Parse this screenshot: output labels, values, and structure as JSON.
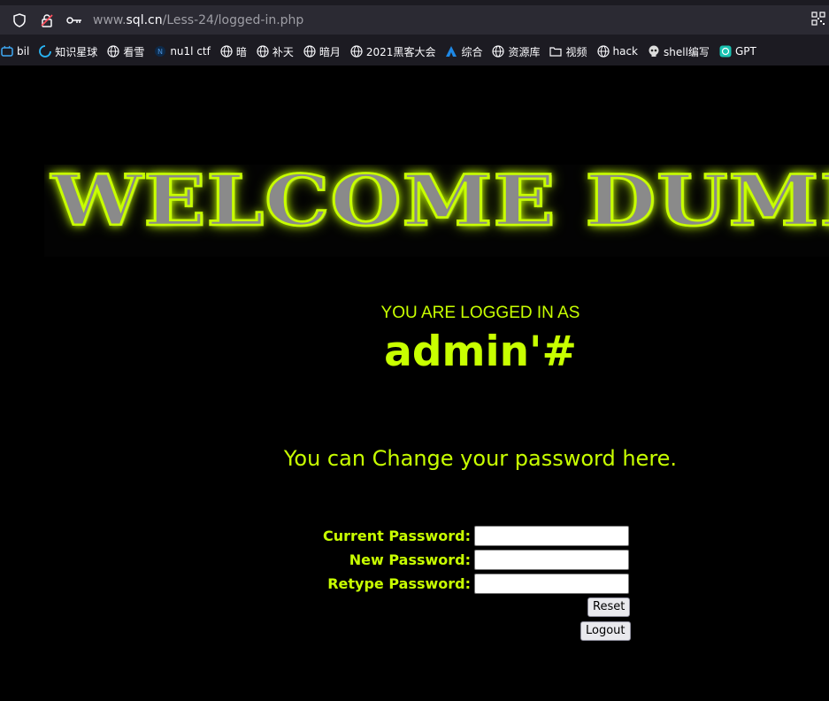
{
  "browser": {
    "url_prefix": "www.",
    "url_domain": "sql.cn",
    "url_path": "/Less-24/logged-in.php",
    "bookmarks": [
      {
        "label": "bil",
        "icon": "bilibili-icon"
      },
      {
        "label": "知识星球",
        "icon": "planet-icon"
      },
      {
        "label": "看雪",
        "icon": "globe-icon"
      },
      {
        "label": "nu1l ctf",
        "icon": "nu1l-icon"
      },
      {
        "label": "暗",
        "icon": "globe-icon"
      },
      {
        "label": "补天",
        "icon": "globe-icon"
      },
      {
        "label": "暗月",
        "icon": "globe-icon"
      },
      {
        "label": "2021黑客大会",
        "icon": "globe-icon"
      },
      {
        "label": "综合",
        "icon": "triangle-icon"
      },
      {
        "label": "资源库",
        "icon": "globe-icon"
      },
      {
        "label": "视频",
        "icon": "folder-icon"
      },
      {
        "label": "hack",
        "icon": "globe-icon"
      },
      {
        "label": "shell编写",
        "icon": "skull-icon"
      },
      {
        "label": "GPT",
        "icon": "gpt-icon"
      }
    ]
  },
  "page": {
    "banner_text": "WELCOME DUMB",
    "logged_in_label": "YOU ARE LOGGED IN AS",
    "username": "admin'#",
    "change_message": "You can Change your password here.",
    "form": {
      "current_password_label": "Current Password:",
      "new_password_label": "New Password:",
      "retype_password_label": "Retype Password:",
      "current_password_value": "",
      "new_password_value": "",
      "retype_password_value": "",
      "reset_label": "Reset",
      "logout_label": "Logout"
    }
  },
  "colors": {
    "accent": "#c8ff00",
    "background": "#000000"
  }
}
